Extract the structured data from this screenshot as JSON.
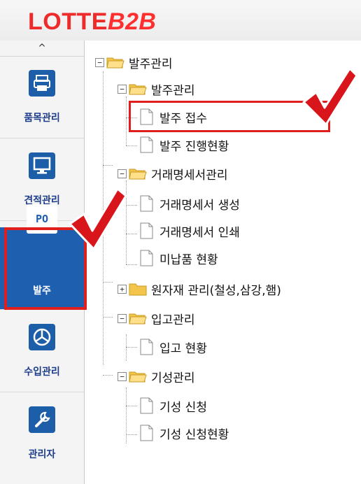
{
  "brand": {
    "logo_main": "LOTTE",
    "logo_accent": "B2B"
  },
  "sidebar": {
    "scroll_up": "^",
    "items": [
      {
        "label": "품목관리",
        "icon": "printer-icon"
      },
      {
        "label": "견적관리",
        "icon": "monitor-icon"
      },
      {
        "label": "발주",
        "icon": "po-icon",
        "badge": "PO",
        "active": true
      },
      {
        "label": "수입관리",
        "icon": "pie-chart-icon"
      },
      {
        "label": "관리자",
        "icon": "wrench-icon"
      }
    ]
  },
  "tree": {
    "root": {
      "label": "발주관리",
      "expander": "−"
    },
    "groups": [
      {
        "label": "발주관리",
        "expander": "−",
        "children": [
          "발주 접수",
          "발주 진행현황"
        ]
      },
      {
        "label": "거래명세서관리",
        "expander": "−",
        "children": [
          "거래명세서 생성",
          "거래명세서 인쇄",
          "미납품 현황"
        ]
      },
      {
        "label": "원자재 관리(철성,삼강,햄)",
        "expander": "+",
        "children": []
      },
      {
        "label": "입고관리",
        "expander": "−",
        "children": [
          "입고 현황"
        ]
      },
      {
        "label": "기성관리",
        "expander": "−",
        "children": [
          "기성 신청",
          "기성 신청현황"
        ]
      }
    ]
  },
  "colors": {
    "brand_red": "#ef2a2a",
    "nav_blue": "#1f5fb0",
    "highlight_red": "#e01e1e",
    "folder_yellow": "#f3c54a"
  }
}
